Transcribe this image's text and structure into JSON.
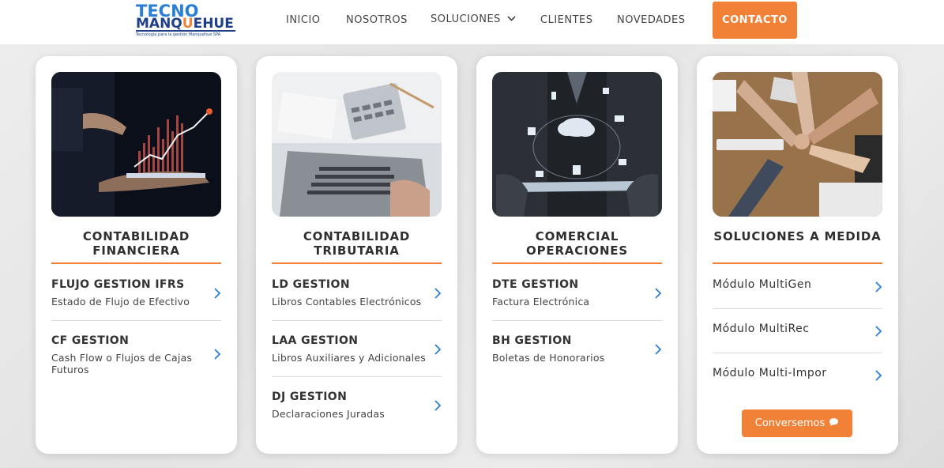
{
  "header": {
    "logo": {
      "line1": "TECNO",
      "line2_a": "MANQ",
      "line2_o": "U",
      "line2_b": "EHUE",
      "tagline": "Tecnología para la gestión Manquehue SPA"
    },
    "nav": {
      "inicio": "INICIO",
      "nosotros": "NOSOTROS",
      "soluciones": "SOLUCIONES",
      "clientes": "CLIENTES",
      "novedades": "NOVEDADES",
      "contacto": "CONTACTO"
    }
  },
  "cards": [
    {
      "title": "CONTABILIDAD FINANCIERA",
      "items": [
        {
          "name": "FLUJO GESTION IFRS",
          "desc": "Estado de Flujo de Efectivo"
        },
        {
          "name": "CF GESTION",
          "desc": "Cash Flow o Flujos de Cajas Futuros"
        }
      ]
    },
    {
      "title": "CONTABILIDAD TRIBUTARIA",
      "items": [
        {
          "name": "LD GESTION",
          "desc": "Libros Contables Electrónicos"
        },
        {
          "name": "LAA GESTION",
          "desc": "Libros Auxiliares y Adicionales"
        },
        {
          "name": "DJ GESTION",
          "desc": "Declaraciones Juradas"
        }
      ]
    },
    {
      "title": "COMERCIAL OPERACIONES",
      "items": [
        {
          "name": "DTE GESTION",
          "desc": "Factura Electrónica"
        },
        {
          "name": "BH GESTION",
          "desc": "Boletas de Honorarios"
        }
      ]
    },
    {
      "title": "SOLUCIONES A MEDIDA",
      "items": [
        {
          "name": "Módulo MultiGen"
        },
        {
          "name": "Módulo MultiRec"
        },
        {
          "name": "Módulo Multi-Impor"
        }
      ],
      "button": "Conversemos"
    }
  ],
  "colors": {
    "accent": "#f08136",
    "link_chevron": "#2a7fd4",
    "logo_blue": "#2a7fd4",
    "logo_navy": "#1e3f8a"
  },
  "icons": [
    "chevron-down-icon",
    "chevron-right-icon",
    "chat-bubble-icon"
  ]
}
